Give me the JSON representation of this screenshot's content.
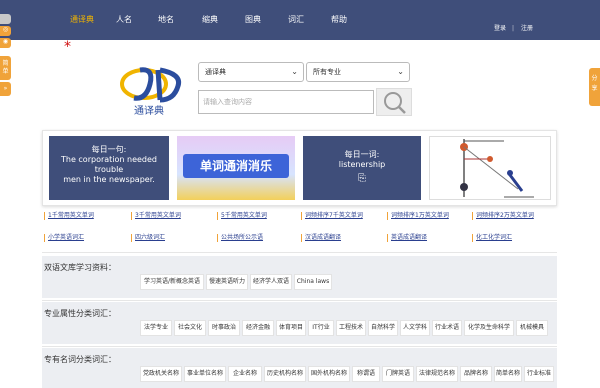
{
  "nav": {
    "items": [
      "通译典",
      "人名",
      "地名",
      "缩典",
      "图典",
      "词汇",
      "帮助"
    ],
    "login": "登录",
    "register": "注册"
  },
  "side": {
    "left_tab": "简单",
    "right_tab": "分享"
  },
  "logo": {
    "text": "通译典"
  },
  "search": {
    "select1": "通译典",
    "select2": "所有专业",
    "placeholder": "请输入查询内容"
  },
  "banner": {
    "card1": {
      "lines": [
        "每日一句:",
        "The corporation needed trouble",
        "men in the newspaper."
      ]
    },
    "card2": {
      "text": "单词通消消乐"
    },
    "card3": {
      "lines": [
        "每日一词:",
        "listenership"
      ]
    }
  },
  "links_row1": [
    "1千常用英文单词",
    "3千常用英文单词",
    "5千常用英文单词",
    "词频排序7千英文单词",
    "词频排序1万英文单词",
    "词频排序2万英文单词"
  ],
  "links_row2": [
    "小学英语词汇",
    "四六级词汇",
    "公共场所公示语",
    "汉语成语翻译",
    "英语成语翻译",
    "化工化学词汇"
  ],
  "sections": [
    {
      "title": "双语文库学习资料：",
      "tags": [
        "学习英语/新概念英语",
        "慢速英语听力",
        "经济学人双语",
        "China laws"
      ]
    },
    {
      "title": "专业属性分类词汇：",
      "tags": [
        "法学专业",
        "社会文化",
        "时事政治",
        "经济金融",
        "体育项目",
        "IT行业",
        "工程技术",
        "自然科学",
        "人文学科",
        "行业术语",
        "化学及生命科学",
        "机械模具"
      ]
    },
    {
      "title": "专有名词分类词汇：",
      "tags": [
        "党政机关名称",
        "事业单位名称",
        "企业名称",
        "历史机构名称",
        "国外机构名称",
        "称谓语",
        "门牌英语",
        "法律规范名称",
        "品牌名称",
        "简单名称",
        "行业标准"
      ]
    }
  ],
  "colors": {
    "nav_bg": "#3f4e7a",
    "accent": "#f0a33a",
    "active_nav": "#f0b400",
    "link": "#2a3f8f"
  }
}
